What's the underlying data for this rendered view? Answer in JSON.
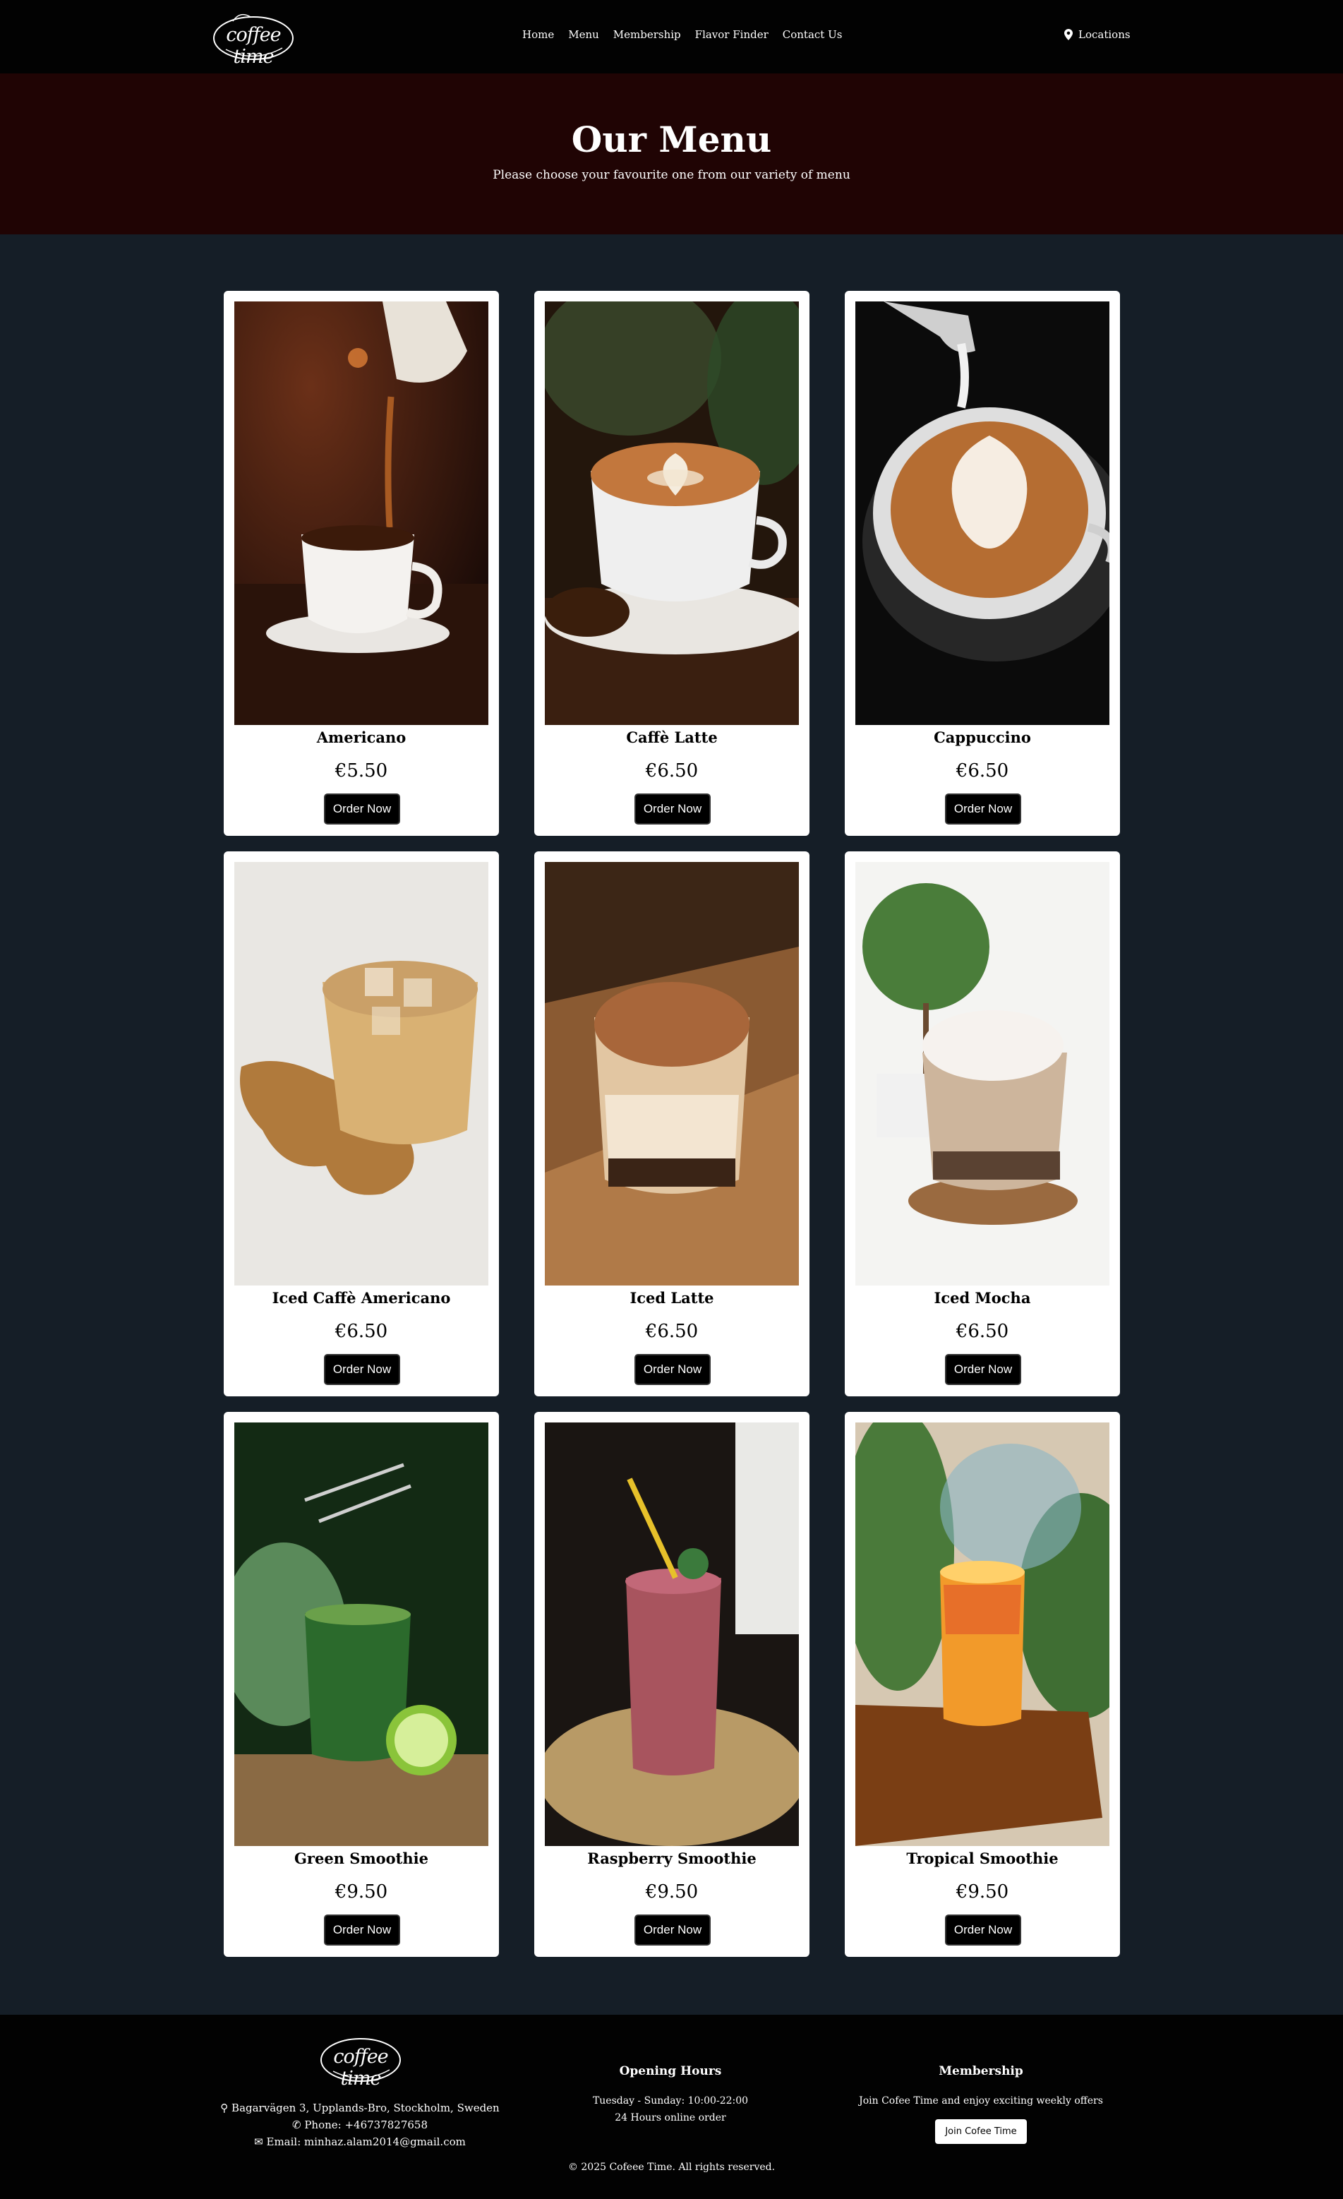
{
  "nav": {
    "logo_text": "coffee time",
    "links": [
      "Home",
      "Menu",
      "Membership",
      "Flavor Finder",
      "Contact Us"
    ],
    "locations": "Locations"
  },
  "hero": {
    "title": "Our Menu",
    "subtitle": "Please choose your favourite one from our variety of menu"
  },
  "menu": [
    {
      "name": "Americano",
      "price": "€5.50",
      "button": "Order Now",
      "image": "americano-photo"
    },
    {
      "name": "Caffè Latte",
      "price": "€6.50",
      "button": "Order Now",
      "image": "caffe-latte-photo"
    },
    {
      "name": "Cappuccino",
      "price": "€6.50",
      "button": "Order Now",
      "image": "cappuccino-photo"
    },
    {
      "name": "Iced Caffè Americano",
      "price": "€6.50",
      "button": "Order Now",
      "image": "iced-americano-photo"
    },
    {
      "name": "Iced Latte",
      "price": "€6.50",
      "button": "Order Now",
      "image": "iced-latte-photo"
    },
    {
      "name": "Iced Mocha",
      "price": "€6.50",
      "button": "Order Now",
      "image": "iced-mocha-photo"
    },
    {
      "name": "Green Smoothie",
      "price": "€9.50",
      "button": "Order Now",
      "image": "green-smoothie-photo"
    },
    {
      "name": "Raspberry Smoothie",
      "price": "€9.50",
      "button": "Order Now",
      "image": "raspberry-smoothie-photo"
    },
    {
      "name": "Tropical Smoothie",
      "price": "€9.50",
      "button": "Order Now",
      "image": "tropical-smoothie-photo"
    }
  ],
  "footer": {
    "logo_text": "coffee time",
    "address": "Bagarvägen 3, Upplands-Bro, Stockholm, Sweden",
    "phone": "Phone: +46737827658",
    "email": "Email: minhaz.alam2014@gmail.com",
    "hours_title": "Opening Hours",
    "hours_line1": "Tuesday - Sunday: 10:00-22:00",
    "hours_line2": "24 Hours online order",
    "membership_title": "Membership",
    "membership_text": "Join Cofee Time and enjoy exciting weekly offers",
    "membership_button": "Join Cofee Time",
    "copyright": "2025 Cofeee Time. All rights reserved."
  },
  "colors": {
    "nav_bg": "#020202",
    "hero_bg": "#200404",
    "page_bg": "#151e27",
    "card_bg": "#ffffff",
    "button_bg": "#000000"
  }
}
